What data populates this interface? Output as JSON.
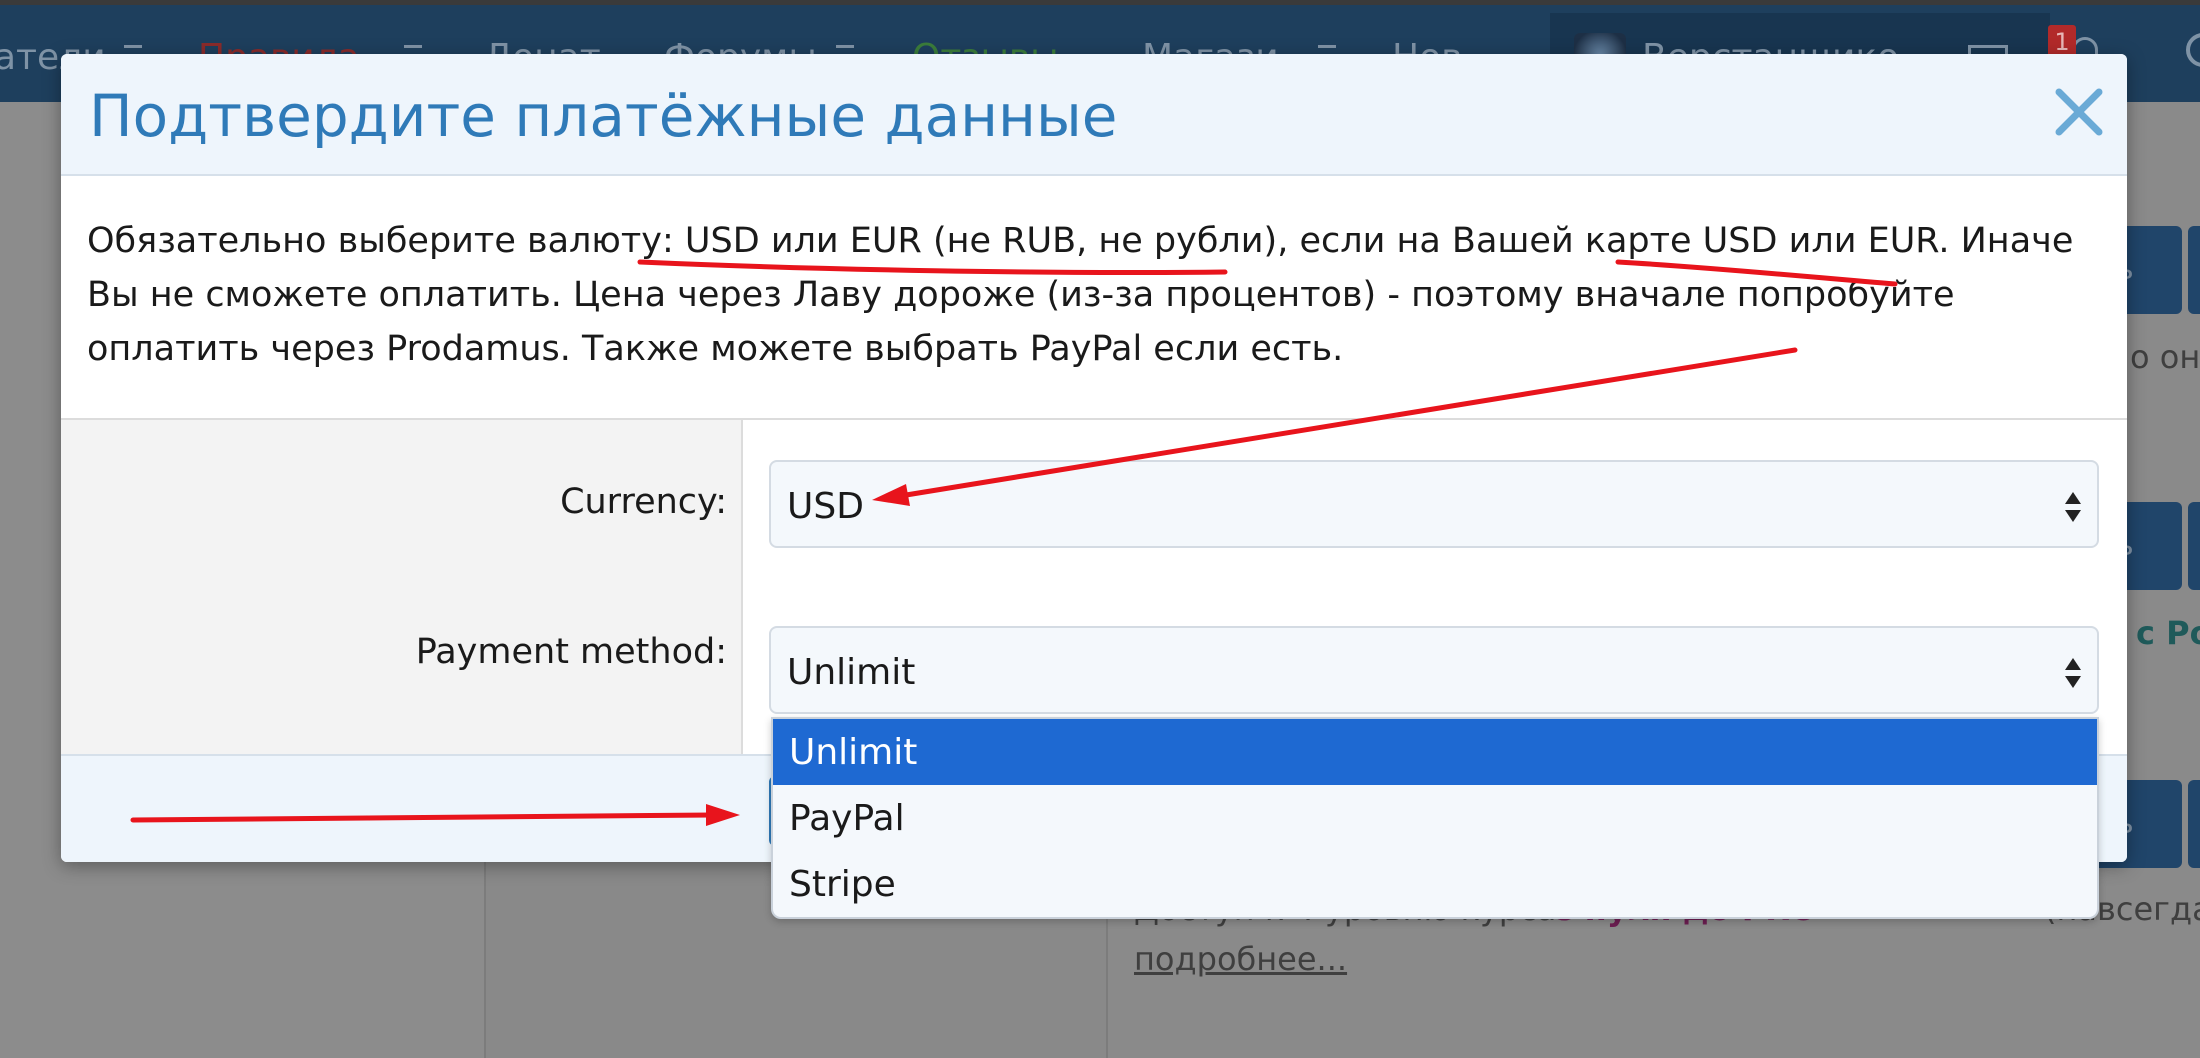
{
  "background": {
    "nav": {
      "items": [
        "атели",
        "Правила",
        "Донат",
        "Форумы",
        "Отзывы",
        "Магази",
        "Нов"
      ],
      "user_name": "Верстанщико",
      "alerts_count": "1"
    },
    "buttons_text": "ь",
    "side_texts": {
      "text_1": "о он",
      "text_2": "с Ро",
      "text_3": "Доступ к 4 уровню курса",
      "text_4": "С нуля до PRO",
      "text_5": "(навсегда",
      "more_link": "подробнее..."
    }
  },
  "modal": {
    "title": "Подтвердите платёжные данные",
    "notice": "Обязательно выберите валюту: USD или EUR (не RUB, не рубли), если на Вашей карте USD или EUR. Иначе Вы не сможете оплатить. Цена через Лаву дороже (из-за процентов) - поэтому вначале попробуйте оплатить через Prodamus. Также можете выбрать PayPal если есть.",
    "currency": {
      "label": "Currency:",
      "value": "USD"
    },
    "payment_method": {
      "label": "Payment method:",
      "value": "Unlimit",
      "options": [
        "Unlimit",
        "PayPal",
        "Stripe"
      ],
      "selected_index": 0
    }
  },
  "colors": {
    "title": "#2f7ab8",
    "selected_option": "#1e69d2",
    "annotation": "#e8141c"
  }
}
